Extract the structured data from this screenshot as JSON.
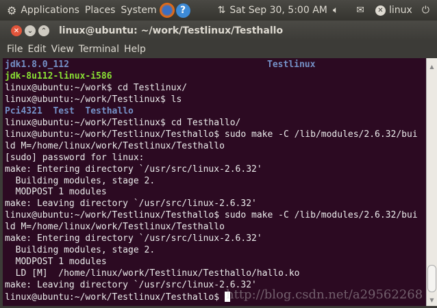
{
  "top_panel": {
    "menus": [
      "Applications",
      "Places",
      "System"
    ],
    "datetime": "Sat Sep 30,  5:00 AM",
    "user": "linux"
  },
  "window": {
    "title": "linux@ubuntu: ~/work/Testlinux/Testhallo"
  },
  "menubar": [
    "File",
    "Edit",
    "View",
    "Terminal",
    "Help"
  ],
  "terminal": {
    "ls_row1": {
      "a": "jdk1.8.0_112",
      "b": "Testlinux"
    },
    "ls_row2": "jdk-8u112-linux-i586",
    "lines_a": [
      "linux@ubuntu:~/work$ cd Testlinux/",
      "linux@ubuntu:~/work/Testlinux$ ls"
    ],
    "ls_row3": "Pci4321  Test  Testhallo",
    "lines_b": [
      "linux@ubuntu:~/work/Testlinux$ cd Testhallo/",
      "linux@ubuntu:~/work/Testlinux/Testhallo$ sudo make -C /lib/modules/2.6.32/bui",
      "ld M=/home/linux/work/Testlinux/Testhallo",
      "[sudo] password for linux:",
      "make: Entering directory `/usr/src/linux-2.6.32'",
      "  Building modules, stage 2.",
      "  MODPOST 1 modules",
      "make: Leaving directory `/usr/src/linux-2.6.32'",
      "linux@ubuntu:~/work/Testlinux/Testhallo$ sudo make -C /lib/modules/2.6.32/bui",
      "ld M=/home/linux/work/Testlinux/Testhallo",
      "make: Entering directory `/usr/src/linux-2.6.32'",
      "  Building modules, stage 2.",
      "  MODPOST 1 modules",
      "  LD [M]  /home/linux/work/Testlinux/Testhallo/hallo.ko",
      "make: Leaving directory `/usr/src/linux-2.6.32'"
    ],
    "prompt": "linux@ubuntu:~/work/Testlinux/Testhallo$ "
  },
  "watermark": "http://blog.csdn.net/a29562268"
}
